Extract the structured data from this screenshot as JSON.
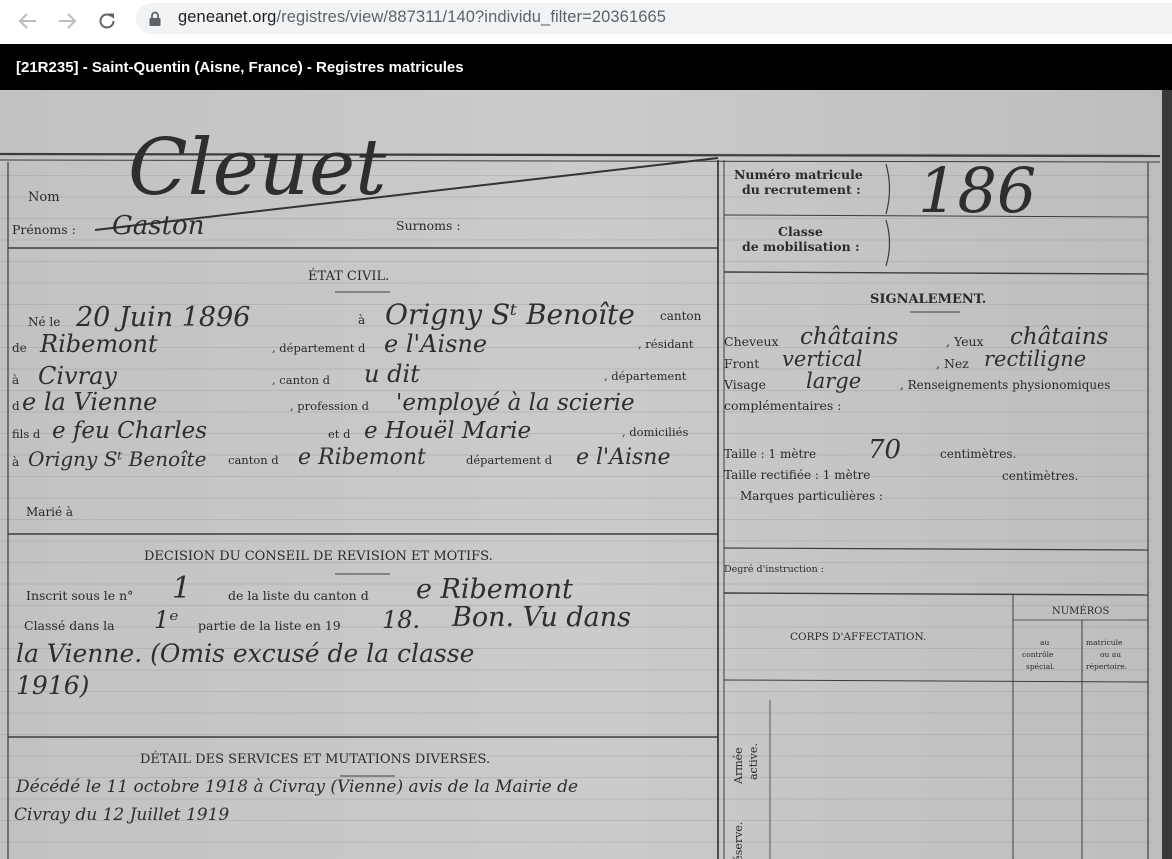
{
  "browser": {
    "url_host": "geneanet.org",
    "url_path": "/registres/view/887311/140?individu_filter=20361665",
    "icons": {
      "back": "arrow-left-icon",
      "forward": "arrow-right-icon",
      "reload": "reload-icon",
      "security": "lock-icon"
    }
  },
  "page": {
    "title": "[21R235] - Saint-Quentin (Aisne, France) - Registres matricules"
  },
  "document": {
    "header": {
      "nom_label": "Nom",
      "nom_value": "Cleuet",
      "prenoms_label": "Prénoms :",
      "prenoms_value": "Gaston",
      "surnoms_label": "Surnoms :",
      "matricule_label_1": "Numéro matricule",
      "matricule_label_2": "du recrutement :",
      "matricule_value": "186",
      "classe_label_1": "Classe",
      "classe_label_2": "de mobilisation :"
    },
    "etat_civil": {
      "heading": "ÉTAT CIVIL.",
      "ne_le_label": "Né le",
      "ne_le_value": "20 Juin 1896",
      "a_label": "à",
      "lieu_naissance": "Origny Sᵗ Benoîte",
      "canton_label": "canton",
      "de_label": "de",
      "canton_value": "Ribemont",
      "departement_label": ", département d",
      "departement_value": "e l'Aisne",
      "resident_label": ", résidant",
      "a_label_2": "à",
      "residence": "Civray",
      "canton_d_label": ", canton d",
      "canton_d_value": "u dit",
      "departement_label_2": ", département",
      "de_label_2": "d",
      "departement_value_2": "e la Vienne",
      "profession_label": ", profession d",
      "profession_value": "'employé à la scierie",
      "fils_label": "fils d",
      "pere_value": "e feu Charles",
      "mere_label": "et d",
      "mere_value": "e Houël Marie",
      "domicilies_label": ", domiciliés",
      "a_label_3": "à",
      "domicile_value": "Origny Sᵗ Benoîte",
      "canton_label_3": "canton d",
      "canton_value_3": "e Ribemont",
      "departement_label_3": "département d",
      "departement_value_3": "e l'Aisne",
      "marie_label": "Marié à"
    },
    "decision": {
      "heading": "DECISION DU CONSEIL DE REVISION ET MOTIFS.",
      "inscrit_label": "Inscrit sous le n°",
      "inscrit_value": "1",
      "liste_label": "de la liste du canton d",
      "liste_value": "e Ribemont",
      "classe_label": "Classé dans la",
      "classe_value": "1ᵉ",
      "partie_label": "partie de la liste en 19",
      "annee_value": "18.",
      "motif_1": "Bon. Vu dans",
      "motif_2": "la Vienne. (Omis excusé de la classe",
      "motif_3": "1916)"
    },
    "detail": {
      "heading": "DÉTAIL DES SERVICES ET MUTATIONS DIVERSES.",
      "line_1": "Décédé le 11 octobre 1918 à Civray (Vienne) avis de la Mairie de",
      "line_2": "Civray du 12 Juillet 1919"
    },
    "signalement": {
      "heading": "SIGNALEMENT.",
      "cheveux_label": "Cheveux",
      "cheveux_value": "châtains",
      "yeux_label": ", Yeux",
      "yeux_value": "châtains",
      "front_label": "Front",
      "front_value": "vertical",
      "nez_label": ", Nez",
      "nez_value": "rectiligne",
      "visage_label": "Visage",
      "visage_value": "large",
      "rens_label": ", Renseignements physionomiques",
      "complementaires_label": "complémentaires :",
      "taille_label": "Taille : 1 mètre",
      "taille_value": "70",
      "centimetres_label": "centimètres.",
      "taille_rect_label": "Taille rectifiée : 1 mètre",
      "centimetres_label_2": "centimètres.",
      "marques_label": "Marques particulières :"
    },
    "instruction_label": "Degré d'instruction :",
    "affectation": {
      "corps_label": "CORPS D'AFFECTATION.",
      "numeros_label": "NUMÉROS",
      "col1_l1": "au",
      "col1_l2": "contrôle",
      "col1_l3": "spécial.",
      "col2_l1": "matricule",
      "col2_l2": "ou au",
      "col2_l3": "répertoire.",
      "armee_active_1": "Armée",
      "armee_active_2": "active.",
      "reserve": "Réserve."
    }
  }
}
